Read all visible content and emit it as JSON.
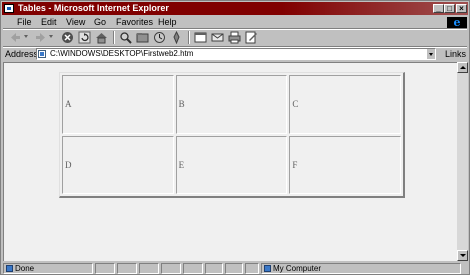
{
  "window": {
    "title": "Tables - Microsoft Internet Explorer",
    "controls": {
      "minimize": "_",
      "maximize": "□",
      "close": "×"
    }
  },
  "menu": [
    "File",
    "Edit",
    "View",
    "Go",
    "Favorites",
    "Help"
  ],
  "toolbar": {
    "buttons": [
      "back-icon",
      "forward-icon",
      "stop-icon",
      "refresh-icon",
      "home-icon",
      "search-icon",
      "favorites-icon",
      "history-icon",
      "channels-icon",
      "fullscreen-icon",
      "mail-icon",
      "print-icon",
      "edit-icon"
    ]
  },
  "address": {
    "label": "Address",
    "url": "C:\\WINDOWS\\DESKTOP\\Firstweb2.htm",
    "links_label": "Links"
  },
  "table": {
    "rows": [
      [
        "A",
        "B",
        "C"
      ],
      [
        "D",
        "E",
        "F"
      ]
    ]
  },
  "status": {
    "text": "Done",
    "zone": "My Computer"
  }
}
